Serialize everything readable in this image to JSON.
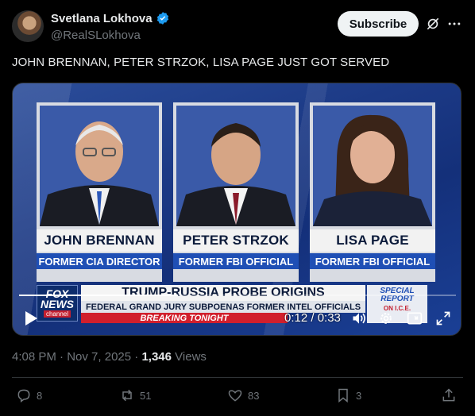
{
  "author": {
    "display_name": "Svetlana Lokhova",
    "handle": "@RealSLokhova",
    "verified": true
  },
  "header": {
    "subscribe_label": "Subscribe",
    "icons": [
      "grok-icon",
      "more-icon"
    ]
  },
  "post": {
    "text": "JOHN BRENNAN, PETER STRZOK, LISA PAGE JUST GOT SERVED"
  },
  "video": {
    "panels": [
      {
        "name": "JOHN BRENNAN",
        "title": "FORMER CIA DIRECTOR"
      },
      {
        "name": "PETER STRZOK",
        "title": "FORMER FBI OFFICIAL"
      },
      {
        "name": "LISA PAGE",
        "title": "FORMER FBI OFFICIAL"
      }
    ],
    "lower_third": {
      "logo_top": "FOX",
      "logo_bottom": "NEWS",
      "logo_channel": "channel",
      "headline": "TRUMP-RUSSIA PROBE ORIGINS",
      "subhead": "FEDERAL GRAND JURY SUBPOENAS FORMER INTEL OFFICIALS",
      "breaking": "BREAKING TONIGHT",
      "special_title": "SPECIAL REPORT",
      "special_sub": "ON I.C.E."
    },
    "player": {
      "current_time": "0:12",
      "duration": "0:33",
      "time_display": "0:12 / 0:33",
      "progress_fraction": 0.364
    }
  },
  "meta": {
    "time": "4:08 PM",
    "date": "Nov 7, 2025",
    "separator": "·",
    "views_count": "1,346",
    "views_label": "Views"
  },
  "actions": {
    "replies": "8",
    "reposts": "51",
    "likes": "83",
    "bookmarks": "3"
  },
  "colors": {
    "background": "#000000",
    "text_primary": "#e7e9ea",
    "text_secondary": "#71767b",
    "verified_blue": "#1d9bf0",
    "fox_blue": "#1f4fb5",
    "breaking_red": "#d11f2c"
  }
}
